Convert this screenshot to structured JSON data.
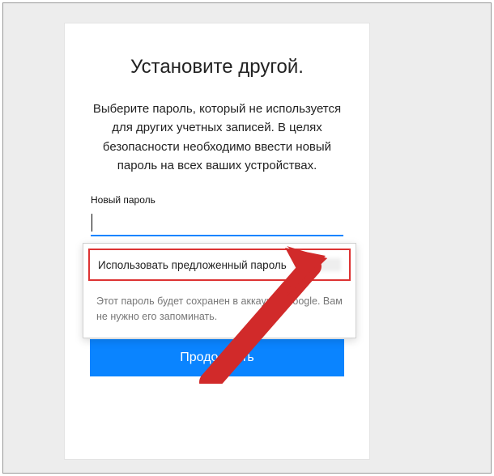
{
  "title": "Установите другой.",
  "description": "Выберите пароль, который не используется для других учетных записей. В целях безопасности необходимо ввести новый пароль на всех ваших устройствах.",
  "field_label": "Новый пароль",
  "password_value": "",
  "suggestion": {
    "label": "Использовать предложенный пароль",
    "info": "Этот пароль будет сохранен в аккаунте Google. Вам не нужно его запоминать."
  },
  "continue_label": "Продолжить",
  "colors": {
    "accent": "#0a84ff",
    "highlight_border": "#d33"
  }
}
